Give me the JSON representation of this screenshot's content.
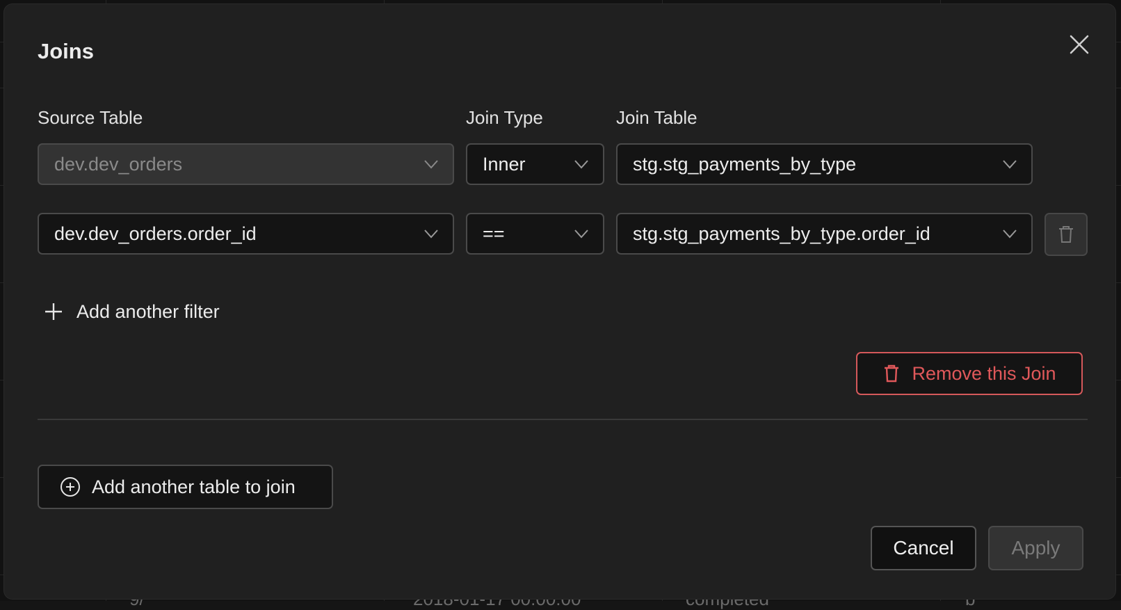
{
  "modal": {
    "title": "Joins"
  },
  "labels": {
    "source_table": "Source Table",
    "join_type": "Join Type",
    "join_table": "Join Table"
  },
  "join": {
    "source_table": "dev.dev_orders",
    "join_type": "Inner",
    "join_table": "stg.stg_payments_by_type"
  },
  "filter": {
    "left_column": "dev.dev_orders.order_id",
    "operator": "==",
    "right_column": "stg.stg_payments_by_type.order_id"
  },
  "actions": {
    "add_filter": "Add another filter",
    "remove_join": "Remove this Join",
    "add_table": "Add another table to join",
    "cancel": "Cancel",
    "apply": "Apply"
  },
  "background": {
    "row_fragments": [
      "9/",
      "2018-01-17 00:00:00",
      "completed",
      "b"
    ]
  },
  "colors": {
    "modal_bg": "#202020",
    "danger": "#e0585a",
    "field_bg": "#141414",
    "disabled_bg": "#333333"
  },
  "icons": {
    "close": "close-icon",
    "chevron": "chevron-down-icon",
    "trash": "trash-icon",
    "plus": "plus-icon",
    "plus_circle": "plus-circle-icon"
  }
}
